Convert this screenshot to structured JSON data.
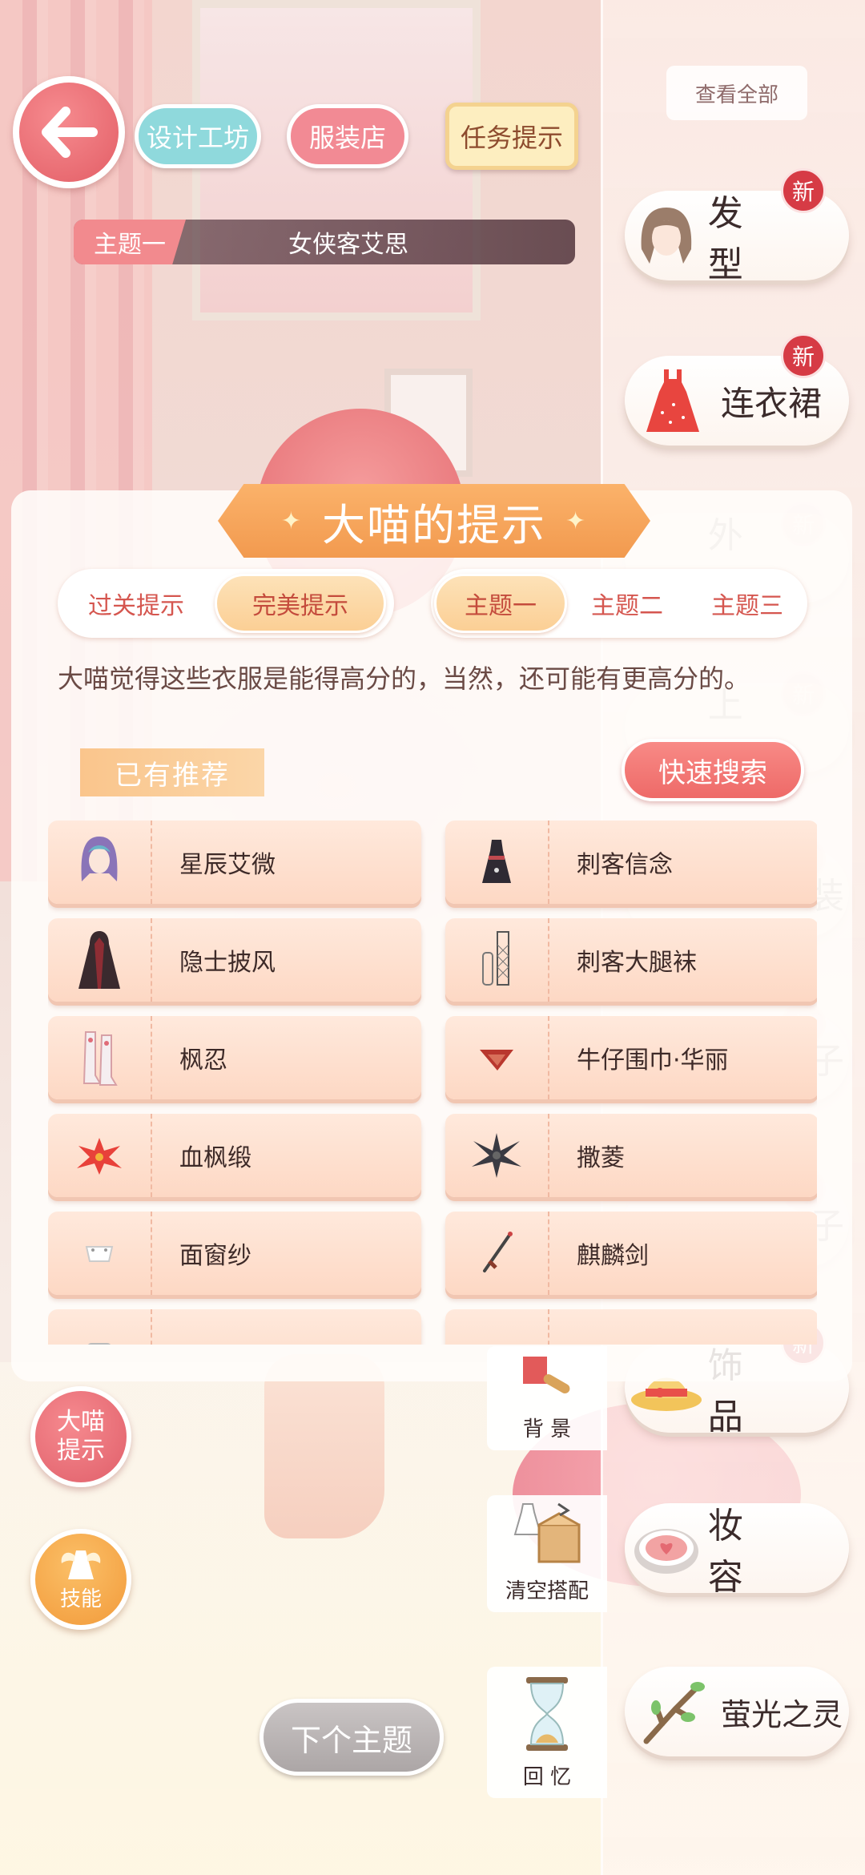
{
  "header": {
    "design_label": "设计工坊",
    "shop_label": "服装店",
    "task_label": "任务提示",
    "view_all_label": "查看全部"
  },
  "theme": {
    "tag": "主题一",
    "name": "女侠客艾思"
  },
  "categories": [
    {
      "label": "发 型",
      "badge": "新",
      "icon": "hairstyle-icon"
    },
    {
      "label": "连衣裙",
      "badge": "新",
      "icon": "dress-icon"
    },
    {
      "label": "外 套",
      "badge": "新",
      "icon": "coat-icon"
    },
    {
      "label": "上 衣",
      "badge": "新",
      "icon": "top-icon"
    },
    {
      "label": "装",
      "badge": "新",
      "icon": "bottom-icon"
    },
    {
      "label": "子",
      "badge": "新",
      "icon": "socks-icon"
    },
    {
      "label": "子",
      "badge": "新",
      "icon": "shoes-icon"
    },
    {
      "label": "饰 品",
      "badge": "新",
      "icon": "hat-icon"
    },
    {
      "label": "妆 容",
      "badge": "",
      "icon": "makeup-icon"
    },
    {
      "label": "萤光之灵",
      "badge": "",
      "icon": "branch-icon"
    }
  ],
  "hint": {
    "title": "大喵的提示",
    "tabs_left": [
      "过关提示",
      "完美提示"
    ],
    "tabs_right": [
      "主题一",
      "主题二",
      "主题三"
    ],
    "active_left": "完美提示",
    "active_right": "主题一",
    "description": "大喵觉得这些衣服是能得高分的，当然，还可能有更高分的。",
    "section_label": "已有推荐",
    "quick_search_label": "快速搜索",
    "items": [
      {
        "name": "星辰艾微",
        "icon": "purple-hair-icon"
      },
      {
        "name": "刺客信念",
        "icon": "black-dress-icon"
      },
      {
        "name": "隐士披风",
        "icon": "cloak-icon"
      },
      {
        "name": "刺客大腿袜",
        "icon": "stockings-icon"
      },
      {
        "name": "枫忍",
        "icon": "boots-icon"
      },
      {
        "name": "牛仔围巾·华丽",
        "icon": "scarf-icon"
      },
      {
        "name": "血枫缎",
        "icon": "red-leaf-icon"
      },
      {
        "name": "撒菱",
        "icon": "caltrop-icon"
      },
      {
        "name": "面窗纱",
        "icon": "veil-icon"
      },
      {
        "name": "麒麟剑",
        "icon": "sword-icon"
      },
      {
        "name": "",
        "icon": "accessory-icon"
      },
      {
        "name": "",
        "icon": "accessory-icon"
      }
    ]
  },
  "bottom": {
    "daimiao_line1": "大喵",
    "daimiao_line2": "提示",
    "skill_label": "技能",
    "next_theme_label": "下个主题",
    "background_label": "背 景",
    "clear_label": "清空搭配",
    "memory_label": "回 忆"
  },
  "colors": {
    "accent_red": "#e35e66",
    "accent_orange": "#f29a4f",
    "badge_red": "#d63b45",
    "item_bg": "#fdd8c4"
  }
}
